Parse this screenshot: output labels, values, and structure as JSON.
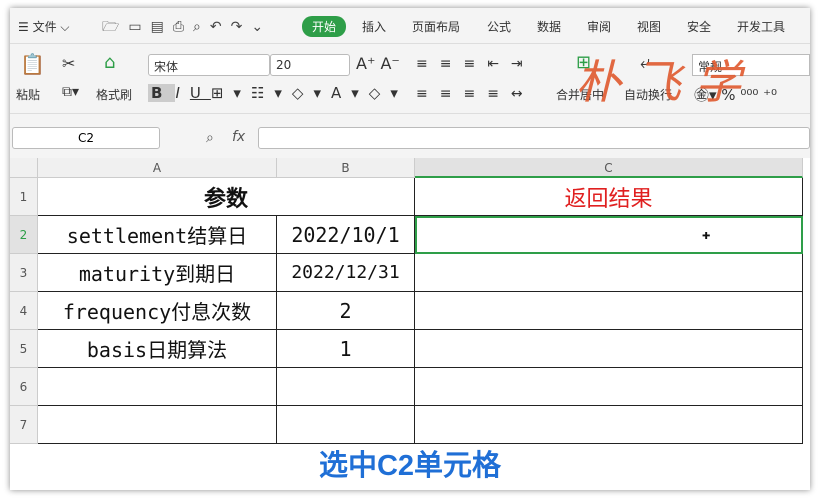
{
  "menu": {
    "file": "文件",
    "tabs": [
      "开始",
      "插入",
      "页面布局",
      "公式",
      "数据",
      "审阅",
      "视图",
      "安全",
      "开发工具"
    ],
    "active_tab": "开始"
  },
  "ribbon": {
    "paste": "粘贴",
    "format_painter": "格式刷",
    "font_name": "宋体",
    "font_size": "20",
    "merge_center": "合并居中",
    "wrap_text": "自动换行",
    "number_format": "常规"
  },
  "formula_bar": {
    "name_box": "C2",
    "fx": "fx",
    "value": ""
  },
  "columns": [
    "A",
    "B",
    "C"
  ],
  "rows": [
    {
      "num": "1",
      "a": "参数",
      "b": "",
      "c": "返回结果"
    },
    {
      "num": "2",
      "a": "settlement结算日",
      "b": "2022/10/1",
      "c": ""
    },
    {
      "num": "3",
      "a": "maturity到期日",
      "b": "2022/12/31",
      "c": ""
    },
    {
      "num": "4",
      "a": "frequency付息次数",
      "b": "2",
      "c": ""
    },
    {
      "num": "5",
      "a": "basis日期算法",
      "b": "1",
      "c": ""
    },
    {
      "num": "6",
      "a": "",
      "b": "",
      "c": ""
    },
    {
      "num": "7",
      "a": "",
      "b": "",
      "c": ""
    }
  ],
  "caption": "选中C2单元格",
  "watermark": "朴飞学",
  "colors": {
    "accent": "#2e9e48",
    "result_header": "#e02020",
    "caption": "#1f6fd6",
    "selection": "#2e9e48"
  }
}
